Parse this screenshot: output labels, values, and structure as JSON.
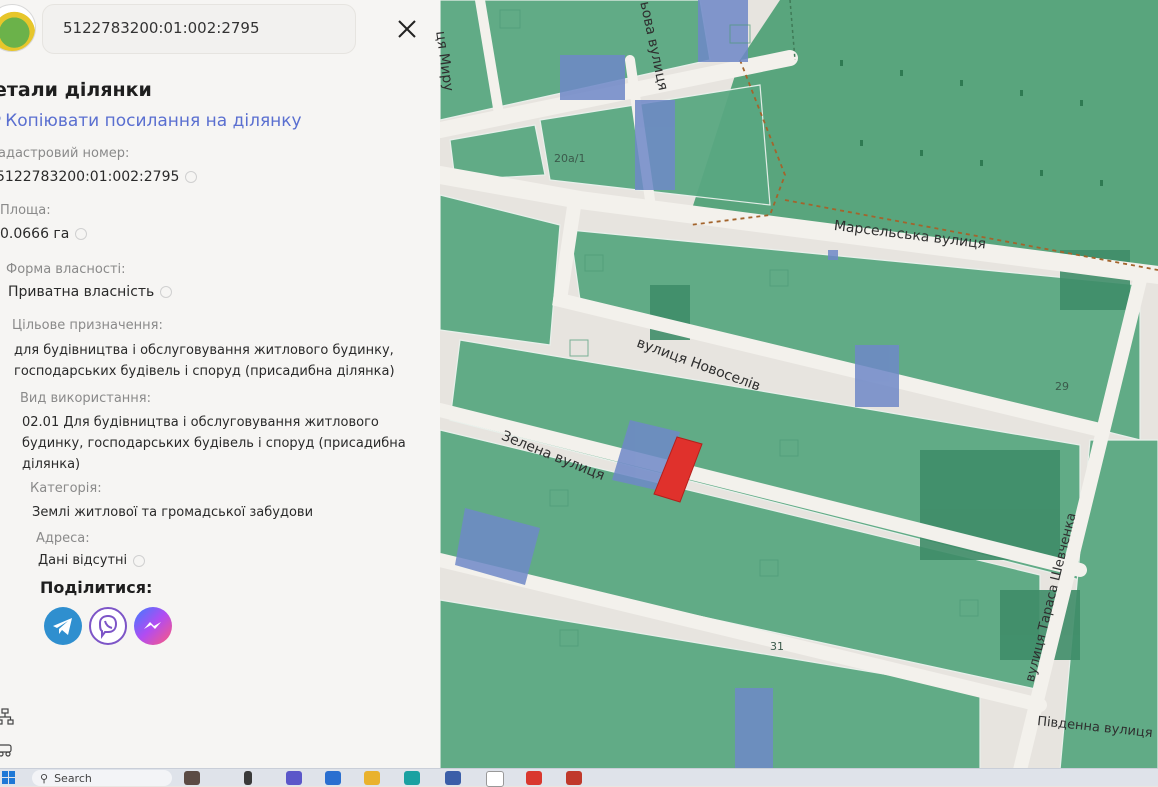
{
  "header": {
    "search_value": "5122783200:01:002:2795"
  },
  "details": {
    "title": "етали ділянки",
    "copy_link": "Копіювати посилання на ділянку",
    "cadastral": {
      "label": "адастровий номер:",
      "value": "5122783200:01:002:2795"
    },
    "area": {
      "label": "Площа:",
      "value": "0.0666 га"
    },
    "ownership": {
      "label": "Форма власності:",
      "value": "Приватна власність"
    },
    "purpose": {
      "label": "Цільове призначення:",
      "value": "для будівництва і обслуговування житлового будинку, господарських будівель і споруд (присадибна ділянка)"
    },
    "usage": {
      "label": "Вид використання:",
      "value": "02.01 Для будівництва і обслуговування житлового будинку, господарських будівель і споруд (присадибна ділянка)"
    },
    "category": {
      "label": "Категорія:",
      "value": "Землі житлової та громадської забудови"
    },
    "address": {
      "label": "Адреса:",
      "value": "Дані відсутні"
    }
  },
  "share": {
    "title": "Поділитися:",
    "buttons": [
      "telegram-icon",
      "viber-icon",
      "messenger-icon"
    ]
  },
  "map": {
    "streets": {
      "myru": "ця Миру",
      "vilkhova": "ьова вулиця",
      "marselska": "Марсельська вулиця",
      "novoseliv": "вулиця Новоселів",
      "zelena": "Зелена вулиця",
      "shevchenka": "вулиця Тараса Шевченка",
      "pivdenna": "Південна вулиця"
    },
    "house_numbers": [
      "20а/1",
      "29",
      "31"
    ],
    "colors": {
      "parcel_green": "#5aa882",
      "parcel_green_dark": "#3f8d69",
      "parcel_blue": "#6f88c8",
      "selected_parcel": "#e0312c",
      "road": "#f3f1ec",
      "park": "#3f9a6c"
    }
  },
  "taskbar": {
    "search_label": "Search"
  }
}
